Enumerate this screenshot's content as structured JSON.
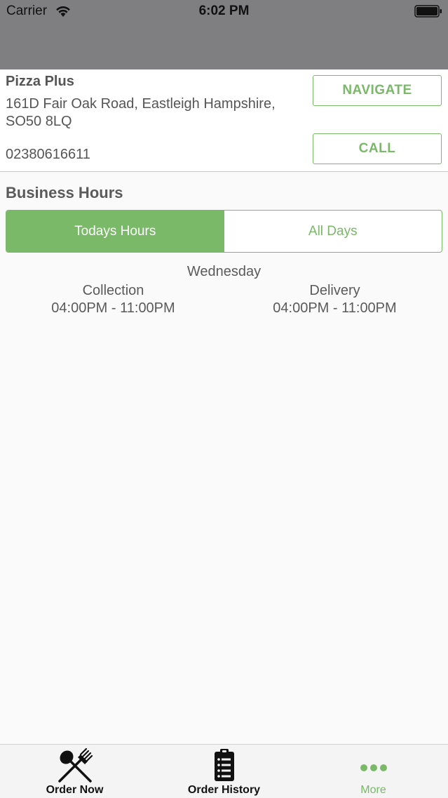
{
  "status_bar": {
    "carrier": "Carrier",
    "time": "6:02 PM"
  },
  "store": {
    "name": "Pizza Plus",
    "address": "161D Fair Oak Road, Eastleigh Hampshire, SO50 8LQ",
    "phone": "02380616611",
    "navigate_label": "NAVIGATE",
    "call_label": "CALL"
  },
  "business_hours": {
    "title": "Business Hours",
    "segments": [
      "Todays Hours",
      "All Days"
    ],
    "selected_segment": "Todays Hours",
    "day": "Wednesday",
    "collection": {
      "label": "Collection",
      "hours": "04:00PM - 11:00PM"
    },
    "delivery": {
      "label": "Delivery",
      "hours": "04:00PM - 11:00PM"
    }
  },
  "tab_bar": {
    "tabs": [
      {
        "label": "Order Now",
        "icon": "fork-spoon-icon"
      },
      {
        "label": "Order History",
        "icon": "clipboard-list-icon"
      },
      {
        "label": "More",
        "icon": "more-dots-icon"
      }
    ],
    "active": "More"
  },
  "colors": {
    "accent": "#79b967",
    "header_grey": "#7f7e80",
    "text": "#5a5a5a"
  }
}
